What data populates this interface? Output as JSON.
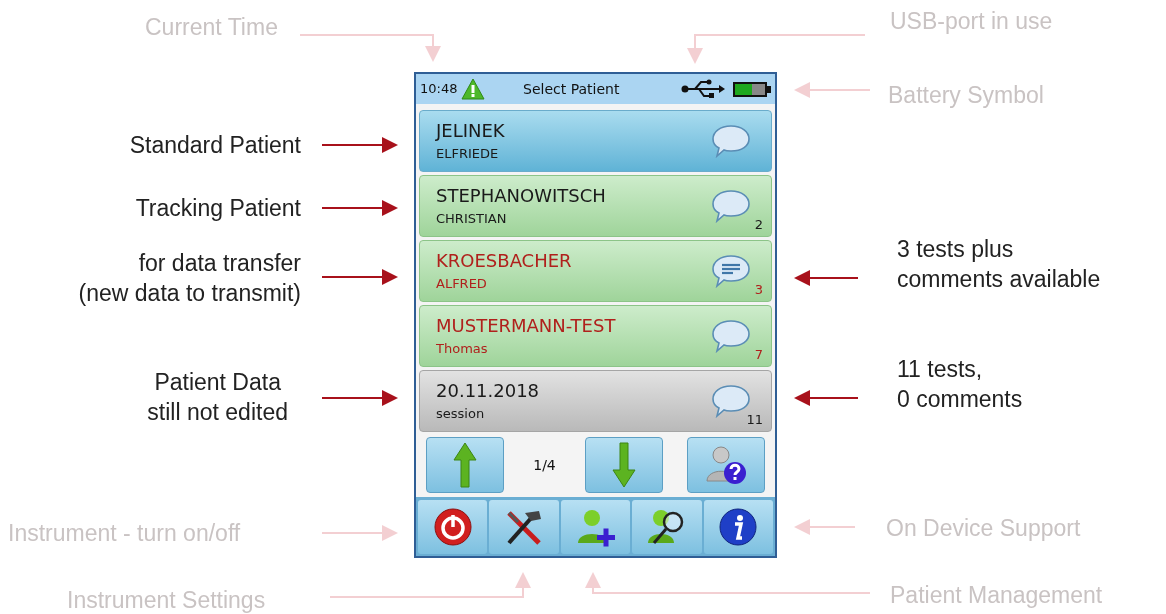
{
  "device": {
    "status_bar": {
      "time": "10:48",
      "title": "Select Patient",
      "warning": true,
      "usb_connected": true,
      "battery": {
        "level": 0.55
      }
    },
    "patients": [
      {
        "kind": "standard",
        "last_name": "JELINEK",
        "first_name": "ELFRIEDE",
        "has_comments": false
      },
      {
        "kind": "tracking",
        "last_name": "STEPHANOWITSCH",
        "first_name": "CHRISTIAN",
        "has_comments": false,
        "tests": "2"
      },
      {
        "kind": "transfer",
        "last_name": "KROESBACHER",
        "first_name": "ALFRED",
        "has_comments": true,
        "tests": "3"
      },
      {
        "kind": "transfer",
        "last_name": "MUSTERMANN-TEST",
        "first_name": "Thomas",
        "has_comments": false,
        "tests": "7"
      },
      {
        "kind": "unedited",
        "last_name": "20.11.2018",
        "first_name": "session",
        "has_comments": false,
        "tests": "11"
      }
    ],
    "page": "1/4",
    "toolbar": [
      {
        "kind": "power"
      },
      {
        "kind": "tools"
      },
      {
        "kind": "add-patient"
      },
      {
        "kind": "search-patient"
      },
      {
        "kind": "info"
      }
    ]
  },
  "annotations": [
    {
      "kind": "faint",
      "lines": [
        "Current Time"
      ]
    },
    {
      "kind": "faint",
      "lines": [
        "USB-port in use"
      ]
    },
    {
      "kind": "faint",
      "lines": [
        "Battery Symbol"
      ]
    },
    {
      "kind": "strong",
      "lines": [
        "Standard Patient"
      ]
    },
    {
      "kind": "strong",
      "lines": [
        "Tracking Patient"
      ]
    },
    {
      "kind": "strong",
      "lines": [
        "for data transfer",
        "(new data to transmit)"
      ]
    },
    {
      "kind": "strong",
      "lines": [
        "3 tests plus",
        "comments available"
      ]
    },
    {
      "kind": "strong",
      "lines": [
        "Patient Data",
        "still not edited"
      ]
    },
    {
      "kind": "strong",
      "lines": [
        "11 tests,",
        "0 comments"
      ]
    },
    {
      "kind": "faint",
      "lines": [
        "Instrument - turn on/off"
      ]
    },
    {
      "kind": "faint",
      "lines": [
        "On Device Support"
      ]
    },
    {
      "kind": "faint",
      "lines": [
        "Instrument Settings"
      ]
    },
    {
      "kind": "faint",
      "lines": [
        "Patient Management"
      ]
    }
  ]
}
